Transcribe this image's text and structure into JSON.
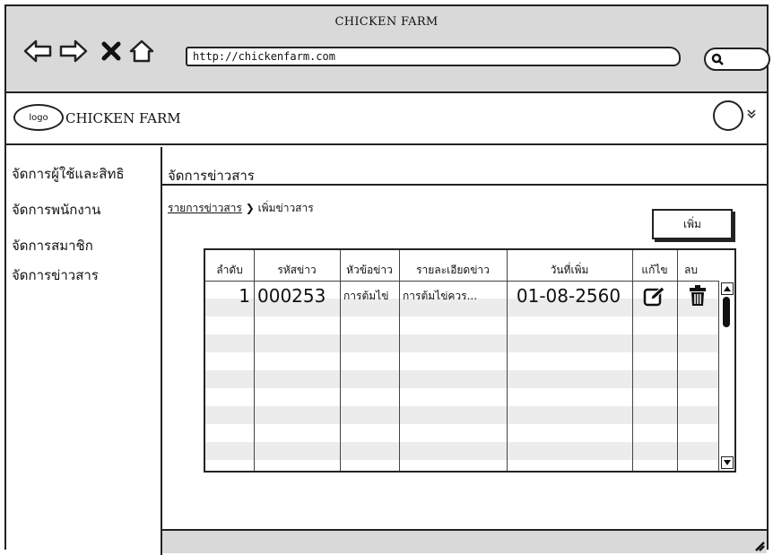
{
  "browser": {
    "window_title": "CHICKEN FARM",
    "url": "http://chickenfarm.com",
    "icons": [
      "back-arrow-icon",
      "forward-arrow-icon",
      "close-x-icon",
      "home-icon",
      "search-icon"
    ]
  },
  "header": {
    "logo_text": "logo",
    "app_name": "CHICKEN FARM",
    "icons": [
      "user-avatar-icon",
      "double-chevron-down-icon"
    ]
  },
  "sidebar": {
    "items": [
      {
        "label": "จัดการผู้ใช้และสิทธิ"
      },
      {
        "label": "จัดการพนักงาน"
      },
      {
        "label": "จัดการสมาชิก"
      },
      {
        "label": "จัดการข่าวสาร"
      }
    ]
  },
  "main": {
    "title": "จัดการข่าวสาร",
    "breadcrumb": {
      "link": "รายการข่าวสาร",
      "separator": "❯",
      "current": "เพิ่มข่าวสาร"
    },
    "add_button_label": "เพิ่ม"
  },
  "table": {
    "columns": [
      "ลำดับ",
      "รหัสข่าว",
      "หัวข้อข่าว",
      "รายละเอียดข่าว",
      "วันที่เพิ่ม",
      "แก้ไข",
      "ลบ"
    ],
    "rows": [
      {
        "order": "1",
        "news_id": "000253",
        "headline": "การต้มไข่",
        "detail": "การต้มไข่ควร...",
        "date_added": "01-08-2560",
        "edit_icon": "edit-icon",
        "delete_icon": "trash-icon"
      }
    ]
  },
  "colors": {
    "chrome": "#d9d9d9",
    "stripe": "#ececec",
    "ink": "#222222"
  }
}
